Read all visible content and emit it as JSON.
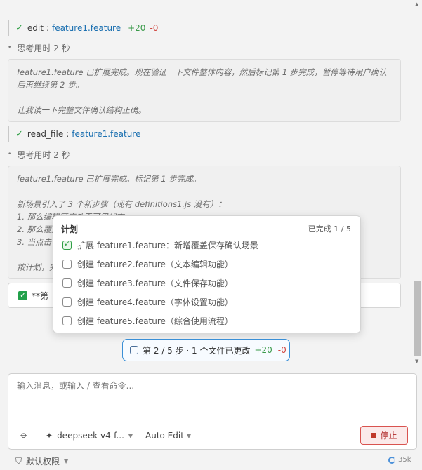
{
  "tool_calls": [
    {
      "name": "edit",
      "file": "feature1.feature",
      "plus": "+20",
      "minus": "-0"
    },
    {
      "name": "read_file",
      "file": "feature1.feature"
    }
  ],
  "thinking": [
    {
      "header": "思考用时 2 秒",
      "lines": [
        "feature1.feature 已扩展完成。现在验证一下文件整体内容，然后标记第 1 步完成，暂停等待用户确认",
        "后再继续第 2 步。",
        "",
        "让我读一下完整文件确认结构正确。"
      ]
    },
    {
      "header": "思考用时 2 秒",
      "lines": [
        "feature1.feature 已扩展完成。标记第 1 步完成。",
        "",
        "新场景引入了 3 个新步骤（现有 definitions1.js 没有）：",
        "1. 那么编辑区应处于可用状态",
        "2. 那么覆盖",
        "3. 当点击",
        "",
        "按计划，完"
      ]
    }
  ],
  "status_text": "**第",
  "plan": {
    "title": "计划",
    "progress": "已完成 1 / 5",
    "items": [
      {
        "label": "扩展 feature1.feature：新增覆盖保存确认场景",
        "done": true
      },
      {
        "label": "创建 feature2.feature（文本编辑功能）",
        "done": false
      },
      {
        "label": "创建 feature3.feature（文件保存功能）",
        "done": false
      },
      {
        "label": "创建 feature4.feature（字体设置功能）",
        "done": false
      },
      {
        "label": "创建 feature5.feature（综合使用流程）",
        "done": false
      }
    ]
  },
  "step_pill": {
    "text": "第 2 / 5 步 · 1 个文件已更改",
    "plus": "+20",
    "minus": "-0"
  },
  "composer": {
    "placeholder": "输入消息，或输入 / 查看命令...",
    "model": "deepseek-v4-f...",
    "mode": "Auto Edit",
    "stop_label": "停止"
  },
  "footer": {
    "permissions": "默认权限",
    "tokens": "35k"
  },
  "colors": {
    "accent": "#3a8fd6",
    "success": "#2e9e44",
    "danger": "#d9534f"
  }
}
